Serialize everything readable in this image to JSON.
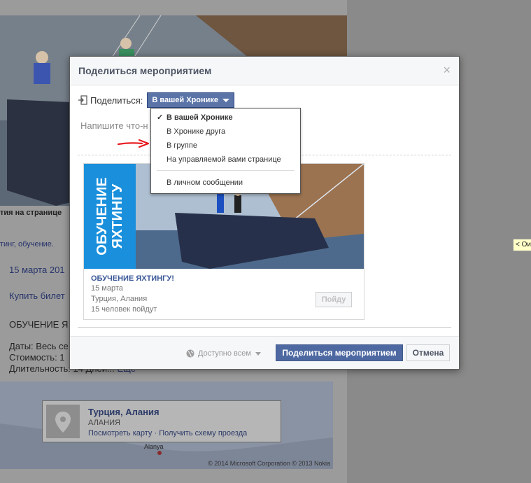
{
  "background": {
    "event_strip": "тия на странице",
    "tags": "тинг, обучение.",
    "date": "15 марта 201",
    "buy": "Купить билет",
    "event_title": "ОБУЧЕНИЕ ЯХ",
    "dates_line": "Даты: Весь се",
    "cost_line": "Стоимость: 1",
    "duration_line": "Длительность: 14 Дней...",
    "more_link": "Еще",
    "map_card": {
      "title": "Турция, Алания",
      "subtitle": "АЛАНИЯ",
      "view_map": "Посмотреть карту",
      "dot": "·",
      "directions": "Получить схему проезда"
    },
    "map_place": "Alanya",
    "map_copyright": "© 2014 Microsoft Corporation © 2013 Nokia",
    "tooltip": "< Ои"
  },
  "dialog": {
    "title": "Поделиться мероприятием",
    "close": "×",
    "share_label": "Поделиться:",
    "share_selected": "В вашей Хронике",
    "compose_placeholder": "Напишите что-н",
    "preview": {
      "banner_line1": "ОБУЧЕНИЕ",
      "banner_line2": "ЯХТИНГУ",
      "title": "ОБУЧЕНИЕ ЯХТИНГУ!",
      "date": "15 марта",
      "location": "Турция, Алания",
      "going": "15 человек пойдут",
      "go_button": "Пойду"
    },
    "audience": "Доступно всем",
    "share_button": "Поделиться мероприятием",
    "cancel_button": "Отмена"
  },
  "dropdown": {
    "check": "✓",
    "items": [
      "В вашей Хронике",
      "В Хронике друга",
      "В группе",
      "На управляемой вами странице",
      "В личном сообщении"
    ]
  },
  "colors": {
    "accent": "#4e69a2",
    "banner": "#1a8fdc",
    "arrow": "#e8191e"
  }
}
